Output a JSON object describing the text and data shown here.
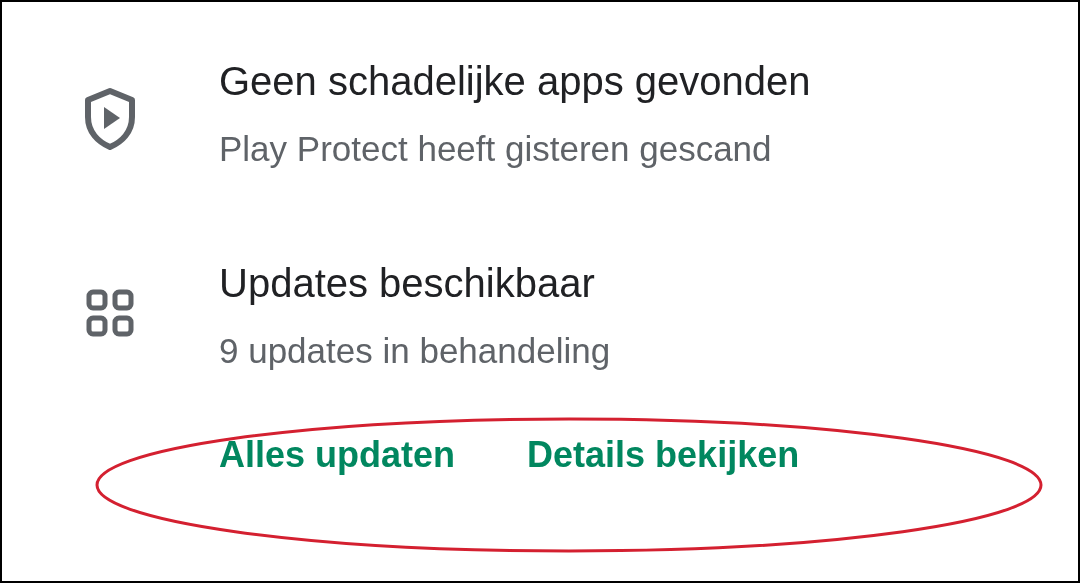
{
  "items": [
    {
      "kind": "protect",
      "title": "Geen schadelijke apps gevonden",
      "subtitle": "Play Protect heeft gisteren gescand"
    },
    {
      "kind": "updates",
      "title": "Updates beschikbaar",
      "subtitle": "9 updates in behandeling"
    }
  ],
  "actions": [
    "Alles updaten",
    "Details bekijken"
  ],
  "annotation": {
    "kind": "ellipse",
    "color": "#d42030"
  }
}
